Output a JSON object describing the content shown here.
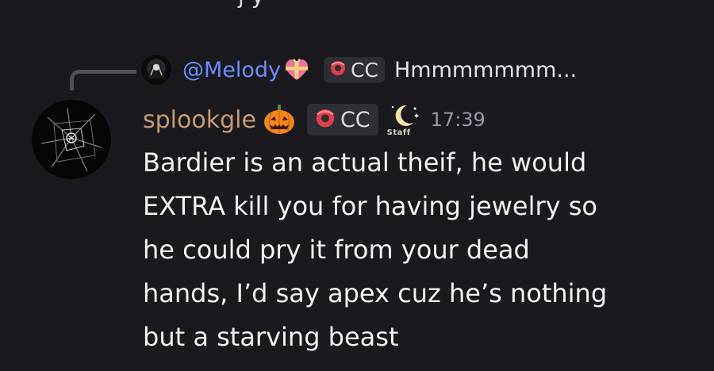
{
  "previous_message": {
    "cutoff_text": "j      y"
  },
  "reply": {
    "author": "@Melody",
    "author_badge_icon": "gift-heart-emoji",
    "role": {
      "label": "CC",
      "icon": "red-donut-icon"
    },
    "preview_text": "Hmmmmmmm..."
  },
  "message": {
    "author": "splookgle",
    "author_color": "#c79a74",
    "author_badge_icon": "jack-o-lantern-emoji",
    "role": {
      "label": "CC",
      "icon": "red-donut-icon"
    },
    "staff_badge": {
      "label": "Staff",
      "icon": "crescent-moon-icon"
    },
    "timestamp": "17:39",
    "lines": [
      "Bardier is an actual theif, he would",
      "EXTRA kill you for having jewelry so",
      "he could pry it from your dead",
      "hands, I’d say apex cuz he’s nothing",
      "but a starving beast"
    ]
  }
}
